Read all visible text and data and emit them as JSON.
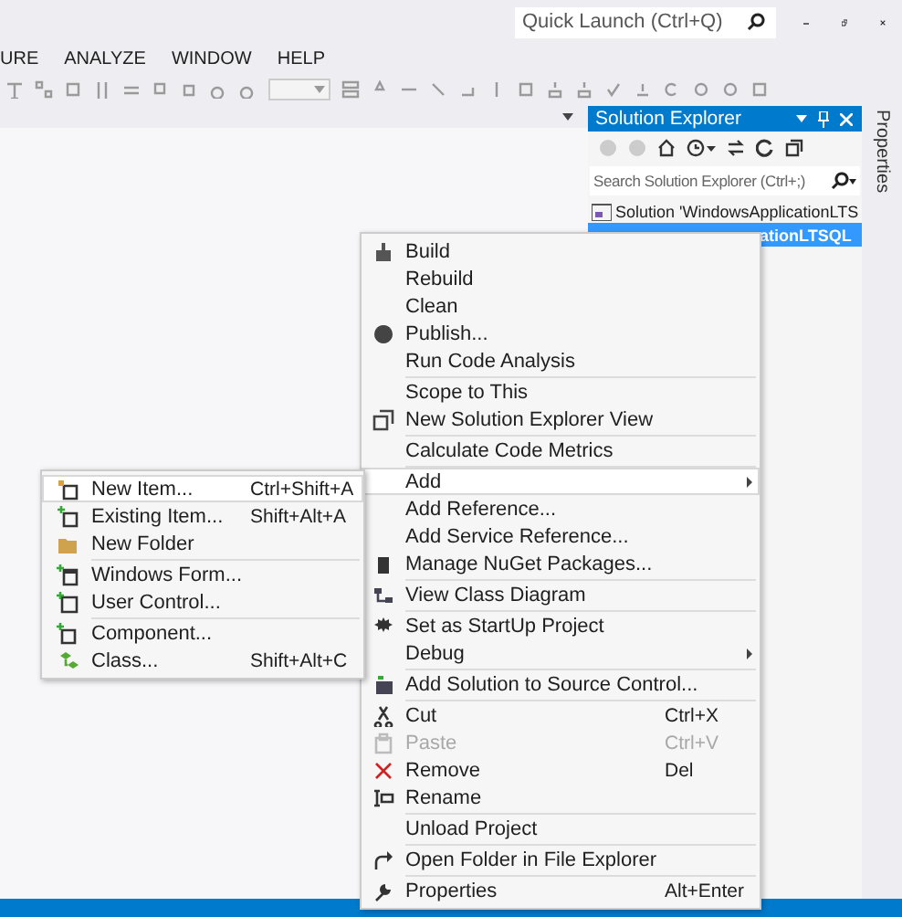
{
  "title_bar": {
    "quick_launch": {
      "placeholder": "Quick Launch (Ctrl+Q)"
    }
  },
  "menu_bar": [
    "URE",
    "ANALYZE",
    "WINDOW",
    "HELP"
  ],
  "solution_explorer": {
    "title": "Solution Explorer",
    "search": {
      "placeholder": "Search Solution Explorer (Ctrl+;)"
    },
    "tree": [
      {
        "label": "Solution 'WindowsApplicationLTS",
        "selected": false,
        "children": [
          {
            "label": "ationLTSQL",
            "selected": true
          }
        ]
      }
    ]
  },
  "properties_tab": "Properties",
  "context_menu": [
    [
      {
        "label": "Build",
        "submenu": false,
        "disabled": false,
        "selected": false
      },
      {
        "label": "Rebuild",
        "submenu": false,
        "disabled": false,
        "selected": false
      },
      {
        "label": "Clean",
        "submenu": false,
        "disabled": false,
        "selected": false
      },
      {
        "label": "Publish...",
        "submenu": false,
        "disabled": false,
        "selected": false
      },
      {
        "label": "Run Code Analysis",
        "submenu": false,
        "disabled": false,
        "selected": false
      }
    ],
    [
      {
        "label": "Scope to This",
        "submenu": false,
        "disabled": false,
        "selected": false
      },
      {
        "label": "New Solution Explorer View",
        "submenu": false,
        "disabled": false,
        "selected": false
      }
    ],
    [
      {
        "label": "Calculate Code Metrics",
        "submenu": false,
        "disabled": false,
        "selected": false
      }
    ],
    [
      {
        "label": "Add",
        "submenu": true,
        "disabled": false,
        "selected": true
      },
      {
        "label": "Add Reference...",
        "submenu": false,
        "disabled": false,
        "selected": false
      },
      {
        "label": "Add Service Reference...",
        "submenu": false,
        "disabled": false,
        "selected": false
      },
      {
        "label": "Manage NuGet Packages...",
        "submenu": false,
        "disabled": false,
        "selected": false
      }
    ],
    [
      {
        "label": "View Class Diagram",
        "submenu": false,
        "disabled": false,
        "selected": false
      }
    ],
    [
      {
        "label": "Set as StartUp Project",
        "submenu": false,
        "disabled": false,
        "selected": false
      },
      {
        "label": "Debug",
        "submenu": true,
        "disabled": false,
        "selected": false
      }
    ],
    [
      {
        "label": "Add Solution to Source Control...",
        "submenu": false,
        "disabled": false,
        "selected": false
      }
    ],
    [
      {
        "label": "Cut",
        "shortcut": "Ctrl+X",
        "submenu": false,
        "disabled": false,
        "selected": false
      },
      {
        "label": "Paste",
        "shortcut": "Ctrl+V",
        "submenu": false,
        "disabled": true,
        "selected": false
      },
      {
        "label": "Remove",
        "shortcut": "Del",
        "submenu": false,
        "disabled": false,
        "selected": false
      },
      {
        "label": "Rename",
        "submenu": false,
        "disabled": false,
        "selected": false
      }
    ],
    [
      {
        "label": "Unload Project",
        "submenu": false,
        "disabled": false,
        "selected": false
      }
    ],
    [
      {
        "label": "Open Folder in File Explorer",
        "submenu": false,
        "disabled": false,
        "selected": false
      }
    ],
    [
      {
        "label": "Properties",
        "shortcut": "Alt+Enter",
        "submenu": false,
        "disabled": false,
        "selected": false
      }
    ]
  ],
  "add_submenu": [
    [
      {
        "label": "New Item...",
        "shortcut": "Ctrl+Shift+A",
        "selected": true
      },
      {
        "label": "Existing Item...",
        "shortcut": "Shift+Alt+A",
        "selected": false
      },
      {
        "label": "New Folder",
        "selected": false
      }
    ],
    [
      {
        "label": "Windows Form...",
        "selected": false
      },
      {
        "label": "User Control...",
        "selected": false
      }
    ],
    [
      {
        "label": "Component...",
        "selected": false
      },
      {
        "label": "Class...",
        "shortcut": "Shift+Alt+C",
        "selected": false
      }
    ]
  ]
}
